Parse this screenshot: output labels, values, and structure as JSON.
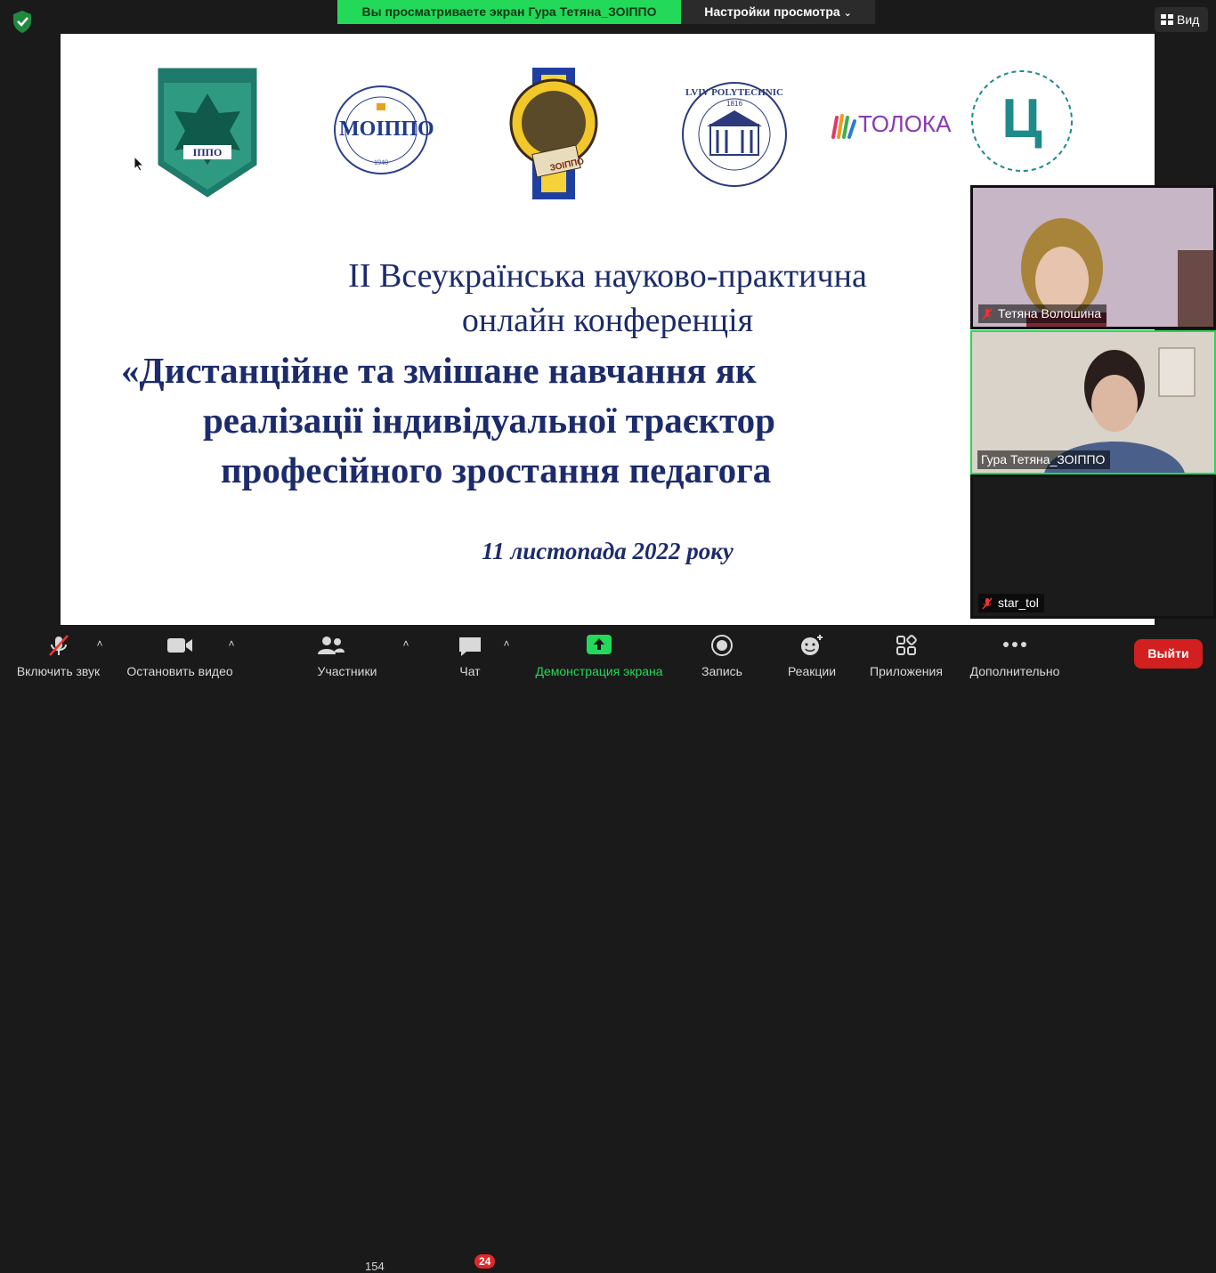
{
  "top": {
    "share_banner": "Вы просматриваете экран Гура Тетяна_ЗОІППО",
    "view_settings": "Настройки просмотра",
    "view_button": "Вид"
  },
  "slide": {
    "logo1_text": "ІППО",
    "logo2_text": "МОІППО",
    "logo2_year": "1940",
    "logo3_text": "ЗОІППО",
    "logo4_text": "LVIV POLYTECHNIC",
    "logo4_year": "1816",
    "logo5_text": "ТОЛОКА",
    "logo6_text": "Ц",
    "title_line1": "ІІ Всеукраїнська науково-практична",
    "title_line2": "онлайн конференція",
    "title_line3": "«Дистанційне та змішане навчання як",
    "title_line4": "реалізації індивідуальної траєктор",
    "title_line5": "професійного зростання педагога",
    "date": "11   листопада 2022 року"
  },
  "participants": [
    {
      "name": "Тетяна Волошина",
      "muted": true
    },
    {
      "name": "Гура Тетяна_ЗОІППО",
      "muted": false
    },
    {
      "name": "star_tol",
      "muted": true
    }
  ],
  "toolbar": {
    "unmute": "Включить звук",
    "stop_video": "Остановить видео",
    "participants": "Участники",
    "participants_count": "154",
    "chat": "Чат",
    "chat_badge": "24",
    "share_screen": "Демонстрация экрана",
    "record": "Запись",
    "reactions": "Реакции",
    "apps": "Приложения",
    "more": "Дополнительно",
    "leave": "Выйти"
  },
  "colors": {
    "accent_green": "#23d959",
    "leave_red": "#d21f1f",
    "slide_text": "#1c2b6b"
  }
}
